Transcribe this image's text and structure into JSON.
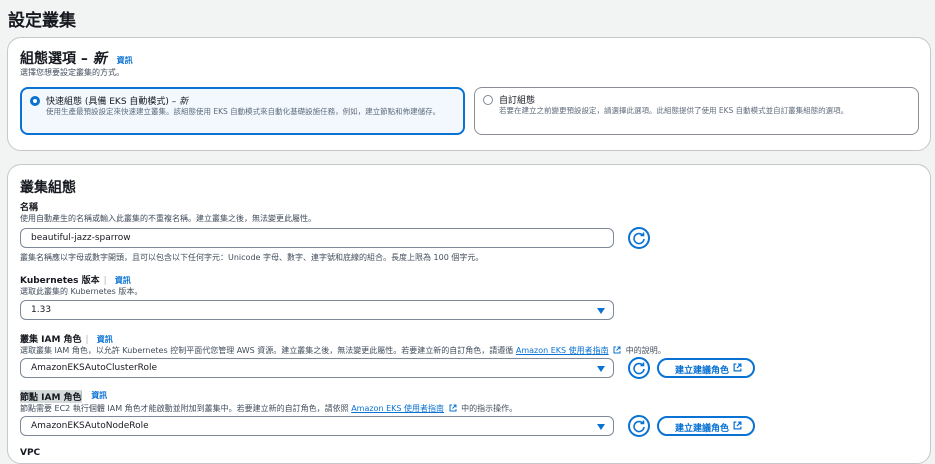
{
  "page": {
    "title": "設定叢集"
  },
  "config_options": {
    "heading": "組態選項 – ",
    "heading_em": "新",
    "info": "資訊",
    "description": "選擇您想要設定叢集的方式。",
    "quick": {
      "title": "快速組態 (具備 EKS 自動模式) – ",
      "title_em": "新",
      "description": "使用生產最預設設定來快速建立叢集。該組態使用 EKS 自動模式來自動化基礎設施任務，例如，建立節點和佈建儲存。"
    },
    "custom": {
      "title": "自訂組態",
      "description": "若要在建立之前變更預設設定，請選擇此選項。此組態提供了使用 EKS 自動模式並自訂叢集組態的選項。"
    }
  },
  "cluster_config": {
    "heading": "叢集組態",
    "name": {
      "label": "名稱",
      "description": "使用自動產生的名稱或輸入此叢集的不重複名稱。建立叢集之後，無法變更此屬性。",
      "value": "beautiful-jazz-sparrow",
      "constraint": "叢集名稱應以字母或數字開頭，且可以包含以下任何字元：Unicode 字母、數字、連字號和底線的組合。長度上限為 100 個字元。"
    },
    "k8s_version": {
      "label": "Kubernetes 版本",
      "info": "資訊",
      "description": "選取此叢集的 Kubernetes 版本。",
      "value": "1.33"
    },
    "cluster_role": {
      "label": "叢集 IAM 角色",
      "info": "資訊",
      "description_before": "選取叢集 IAM 角色，以允許 Kubernetes 控制平面代您管理 AWS 資源。建立叢集之後，無法變更此屬性。若要建立新的自訂角色，請遵循",
      "link": "Amazon EKS 使用者指南",
      "description_after": "中的說明。",
      "value": "AmazonEKSAutoClusterRole",
      "create_button": "建立建議角色"
    },
    "node_role": {
      "label": "節點 IAM 角色",
      "info": "資訊",
      "description_before": "節點需要 EC2 執行個體 IAM 角色才能啟動並附加到叢集中。若要建立新的自訂角色，請依照",
      "link": "Amazon EKS 使用者指南",
      "description_after": "中的指示操作。",
      "value": "AmazonEKSAutoNodeRole",
      "create_button": "建立建議角色"
    },
    "vpc": {
      "label": "VPC"
    }
  },
  "colors": {
    "accent": "#0972d3",
    "border": "#7d8998",
    "page_bg": "#f2f3f3"
  }
}
